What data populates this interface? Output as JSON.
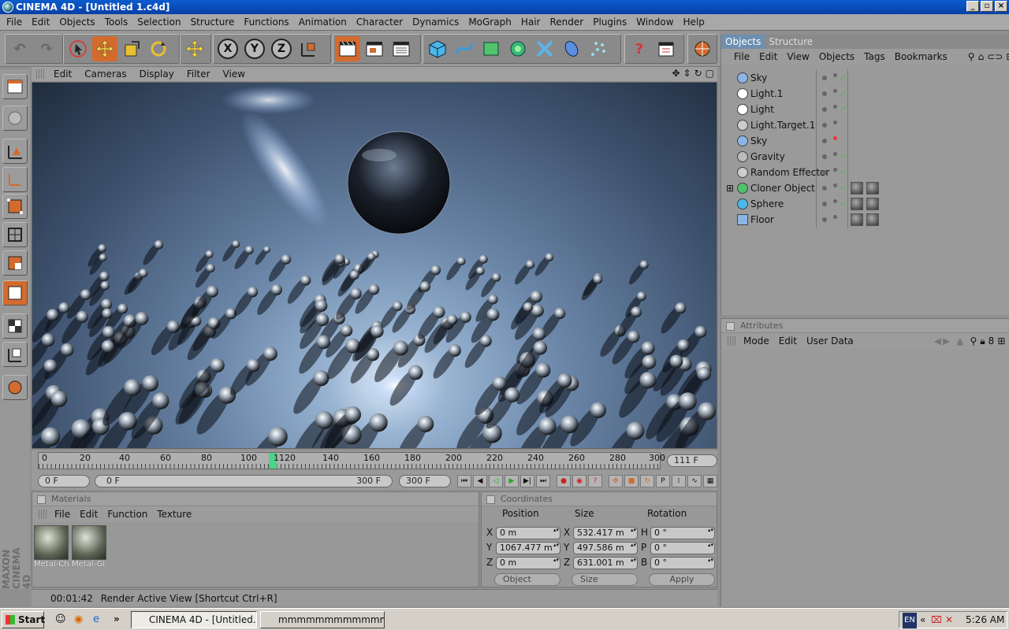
{
  "window": {
    "title": "CINEMA 4D - [Untitled 1.c4d]"
  },
  "menu": [
    "File",
    "Edit",
    "Objects",
    "Tools",
    "Selection",
    "Structure",
    "Functions",
    "Animation",
    "Character",
    "Dynamics",
    "MoGraph",
    "Hair",
    "Render",
    "Plugins",
    "Window",
    "Help"
  ],
  "viewport": {
    "menu": [
      "Edit",
      "Cameras",
      "Display",
      "Filter",
      "View"
    ]
  },
  "timeline": {
    "ticks": [
      "0",
      "20",
      "40",
      "60",
      "80",
      "100",
      "1120",
      "140",
      "160",
      "180",
      "200",
      "220",
      "240",
      "260",
      "280",
      "300"
    ],
    "current_frame": "111 F",
    "start_frame": "0 F",
    "range_start": "0 F",
    "range_end": "300 F",
    "end_frame": "300 F",
    "playhead_fraction": 0.37
  },
  "materials": {
    "title": "Materials",
    "menu": [
      "File",
      "Edit",
      "Function",
      "Texture"
    ],
    "items": [
      "Metal-Ch",
      "Metal-Gl"
    ]
  },
  "coordinates": {
    "title": "Coordinates",
    "headers": [
      "Position",
      "Size",
      "Rotation"
    ],
    "rows": [
      {
        "axis": "X",
        "pos": "0 m",
        "size_axis": "X",
        "size": "532.417 m",
        "rot_axis": "H",
        "rot": "0 °"
      },
      {
        "axis": "Y",
        "pos": "1067.477 m",
        "size_axis": "Y",
        "size": "497.586 m",
        "rot_axis": "P",
        "rot": "0 °"
      },
      {
        "axis": "Z",
        "pos": "0 m",
        "size_axis": "Z",
        "size": "631.001 m",
        "rot_axis": "B",
        "rot": "0 °"
      }
    ],
    "mode": "Object",
    "size_mode": "Size",
    "apply": "Apply"
  },
  "status": {
    "time": "00:01:42",
    "message": "Render Active View [Shortcut Ctrl+R]"
  },
  "objects_panel": {
    "tabs": [
      "Objects",
      "Structure"
    ],
    "menu": [
      "File",
      "Edit",
      "View",
      "Objects",
      "Tags",
      "Bookmarks"
    ],
    "items": [
      {
        "name": "Sky",
        "icon": "sky-icon",
        "vis": "check"
      },
      {
        "name": "Light.1",
        "icon": "light-icon",
        "vis": "check"
      },
      {
        "name": "Light",
        "icon": "light-icon",
        "vis": "check"
      },
      {
        "name": "Light.Target.1",
        "icon": "target-icon",
        "vis": ""
      },
      {
        "name": "Sky",
        "icon": "sky-icon",
        "vis": "red"
      },
      {
        "name": "Gravity",
        "icon": "gravity-icon",
        "vis": "check"
      },
      {
        "name": "Random Effector",
        "icon": "effector-icon",
        "vis": "check"
      },
      {
        "name": "Cloner Object",
        "icon": "cloner-icon",
        "vis": "check"
      },
      {
        "name": "Sphere",
        "icon": "sphere-icon",
        "vis": "check"
      },
      {
        "name": "Floor",
        "icon": "floor-icon",
        "vis": ""
      }
    ]
  },
  "attributes": {
    "title": "Attributes",
    "menu": [
      "Mode",
      "Edit",
      "User Data"
    ]
  },
  "taskbar": {
    "start": "Start",
    "tasks": [
      "CINEMA 4D - [Untitled...",
      "mmmmmmmmmmmmmmmm..."
    ],
    "lang": "EN",
    "clock": "5:26 AM"
  },
  "colors": {
    "accent": "#d36b2e",
    "tab_active": "#6d8fb0",
    "check": "#3bc43b",
    "playhead": "#4fd38a"
  }
}
